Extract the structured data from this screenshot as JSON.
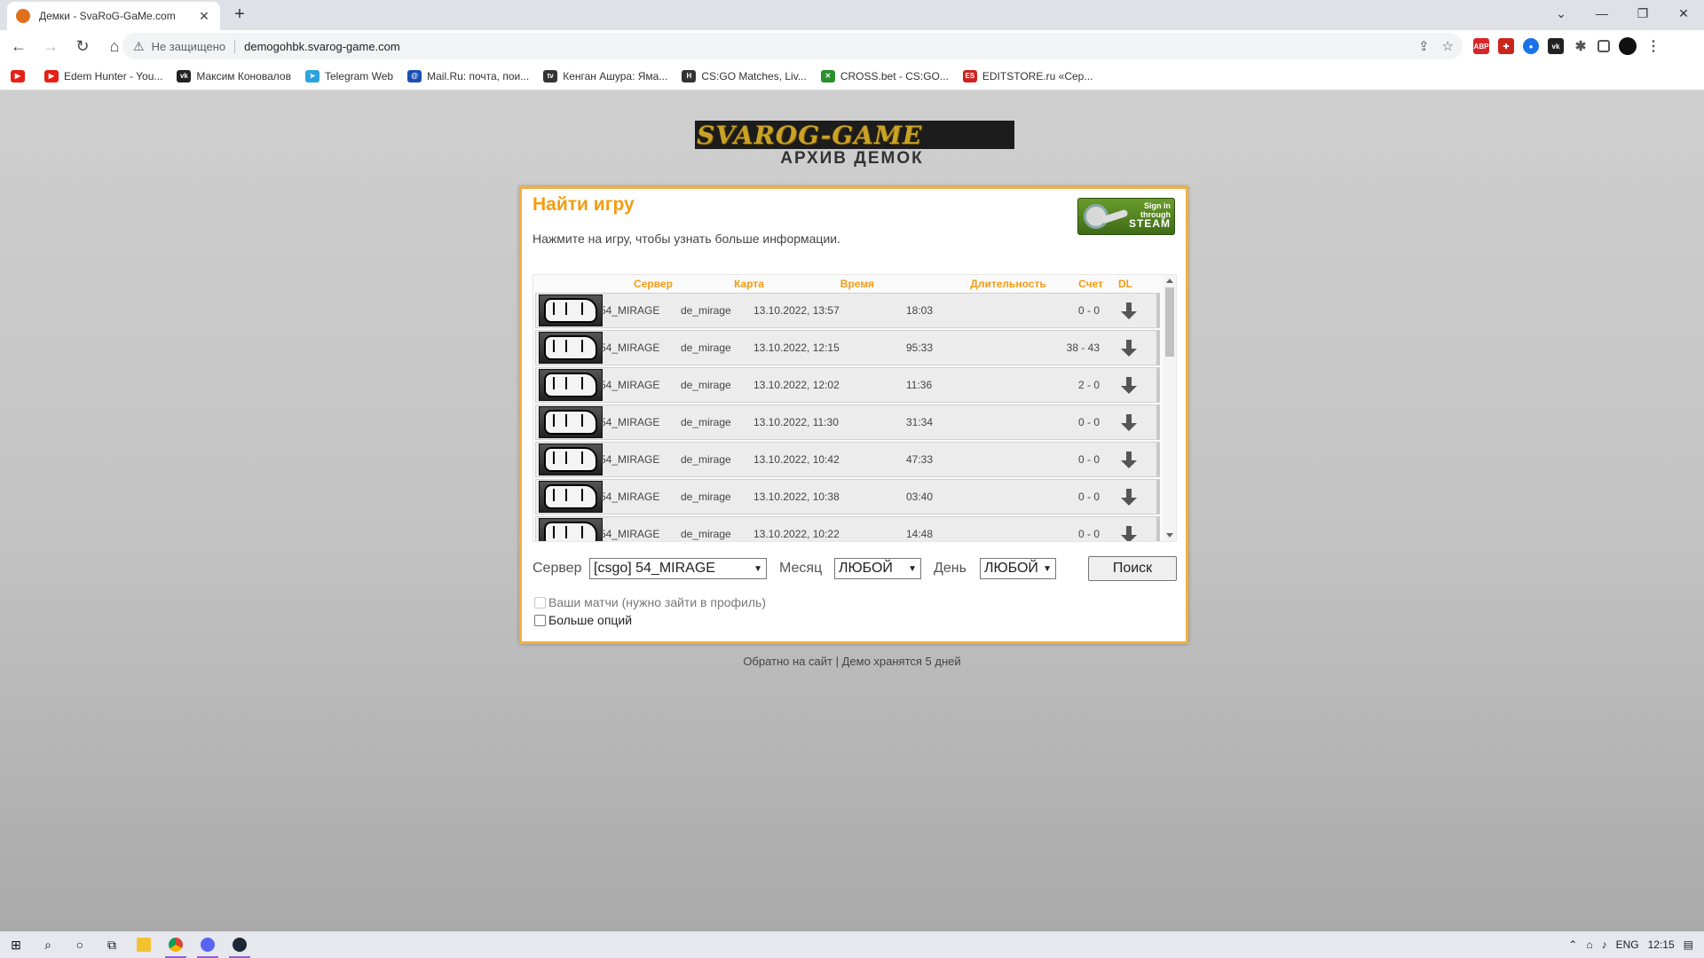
{
  "browser": {
    "tab_title": "Демки - SvaRoG-GaMe.com",
    "tab_close": "✕",
    "new_tab": "+",
    "security_label": "Не защищено",
    "url": "demogohbk.svarog-game.com",
    "window_buttons": [
      "⌄",
      "—",
      "❐",
      "✕"
    ],
    "extensions": [
      {
        "name": "abp",
        "label": "ABP",
        "color": "#d9252a"
      },
      {
        "name": "red-ext",
        "label": "✚",
        "color": "#c8261c"
      },
      {
        "name": "blue-ext",
        "label": "●",
        "color": "#1a73e8"
      },
      {
        "name": "vk-ext",
        "label": "vk",
        "color": "#222"
      }
    ]
  },
  "bookmarks": [
    {
      "icon": "youtube-icon",
      "color": "#e62117",
      "glyph": "▶",
      "label": ""
    },
    {
      "icon": "youtube-icon",
      "color": "#e62117",
      "glyph": "▶",
      "label": "Edem Hunter - You..."
    },
    {
      "icon": "vk-icon",
      "color": "#222",
      "glyph": "vk",
      "label": "Максим Коновалов"
    },
    {
      "icon": "telegram-icon",
      "color": "#2aa3df",
      "glyph": "➤",
      "label": "Telegram Web"
    },
    {
      "icon": "mailru-icon",
      "color": "#1a4fb5",
      "glyph": "@",
      "label": "Mail.Ru: почта, пои..."
    },
    {
      "icon": "tv-icon",
      "color": "#333",
      "glyph": "tv",
      "label": "Кенган Ашура: Яма..."
    },
    {
      "icon": "hltv-icon",
      "color": "#333",
      "glyph": "H",
      "label": "CS:GO Matches, Liv..."
    },
    {
      "icon": "crossbet-icon",
      "color": "#2b8f2b",
      "glyph": "✕",
      "label": "CROSS.bet - CS:GO..."
    },
    {
      "icon": "editstore-icon",
      "color": "#d02020",
      "glyph": "ES",
      "label": "EDITSTORE.ru «Сер..."
    }
  ],
  "page": {
    "logo_text": "SVAROG-GAME",
    "archive_title": "АРХИВ ДЕМОК",
    "panel_title": "Найти игру",
    "panel_subtitle": "Нажмите на игру, чтобы узнать больше информации.",
    "steam": {
      "line1": "Sign in",
      "line2": "through",
      "line3": "STEAM"
    },
    "columns": {
      "server": "Сервер",
      "map": "Карта",
      "time": "Время",
      "duration": "Длительность",
      "score": "Счет",
      "dl": "DL"
    },
    "rows": [
      {
        "server": "54_MIRAGE",
        "map": "de_mirage",
        "time": "13.10.2022, 13:57",
        "duration": "18:03",
        "score": "0 - 0"
      },
      {
        "server": "54_MIRAGE",
        "map": "de_mirage",
        "time": "13.10.2022, 12:15",
        "duration": "95:33",
        "score": "38 - 43"
      },
      {
        "server": "54_MIRAGE",
        "map": "de_mirage",
        "time": "13.10.2022, 12:02",
        "duration": "11:36",
        "score": "2 - 0"
      },
      {
        "server": "54_MIRAGE",
        "map": "de_mirage",
        "time": "13.10.2022, 11:30",
        "duration": "31:34",
        "score": "0 - 0"
      },
      {
        "server": "54_MIRAGE",
        "map": "de_mirage",
        "time": "13.10.2022, 10:42",
        "duration": "47:33",
        "score": "0 - 0"
      },
      {
        "server": "54_MIRAGE",
        "map": "de_mirage",
        "time": "13.10.2022, 10:38",
        "duration": "03:40",
        "score": "0 - 0"
      },
      {
        "server": "54_MIRAGE",
        "map": "de_mirage",
        "time": "13.10.2022, 10:22",
        "duration": "14:48",
        "score": "0 - 0"
      }
    ],
    "filters": {
      "server_label": "Сервер",
      "server_value": "[csgo] 54_MIRAGE",
      "month_label": "Месяц",
      "month_value": "ЛЮБОЙ",
      "day_label": "День",
      "day_value": "ЛЮБОЙ",
      "search_button": "Поиск"
    },
    "checkbox_your_matches": "Ваши матчи (нужно зайти в профиль)",
    "checkbox_more_options": "Больше опций",
    "footer_back": "Обратно на сайт",
    "footer_sep": " | ",
    "footer_note": "Демо хранятся 5 дней"
  },
  "taskbar": {
    "lang": "ENG",
    "clock": "12:15"
  }
}
